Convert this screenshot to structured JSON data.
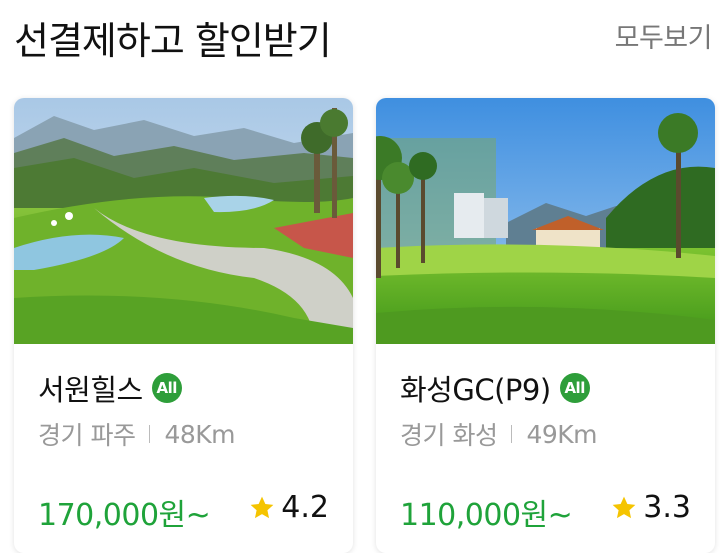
{
  "header": {
    "title": "선결제하고 할인받기",
    "see_all_label": "모두보기"
  },
  "cards": [
    {
      "name": "서원힐스",
      "badge": "All",
      "region": "경기 파주",
      "distance": "48Km",
      "price": "170,000원~",
      "rating": "4.2"
    },
    {
      "name": "화성GC(P9)",
      "badge": "All",
      "region": "경기 화성",
      "distance": "49Km",
      "price": "110,000원~",
      "rating": "3.3"
    }
  ],
  "colors": {
    "price": "#1fa33a",
    "badge": "#2e9e3a",
    "star": "#f5c400"
  }
}
